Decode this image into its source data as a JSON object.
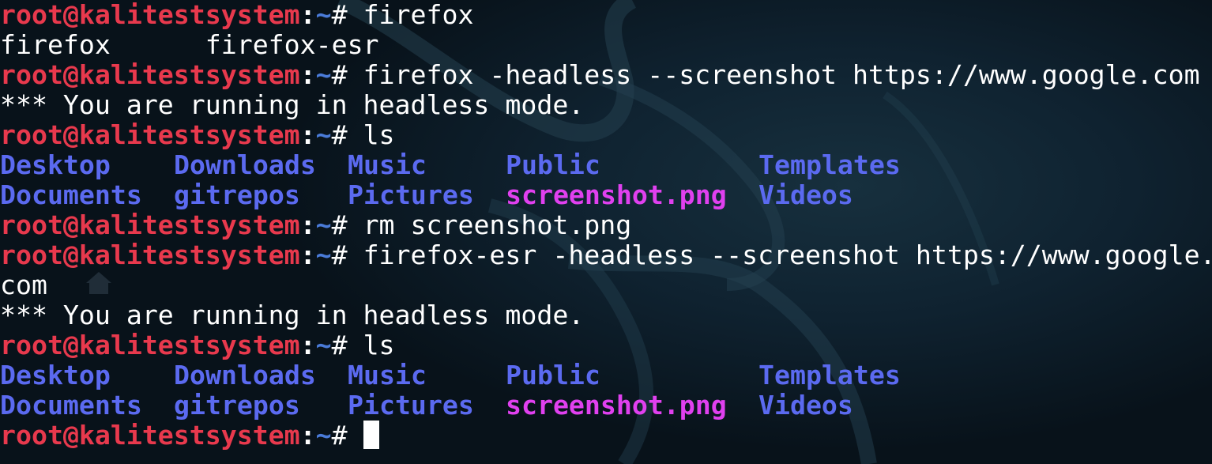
{
  "terminal": {
    "prompt": {
      "user_host": "root@kalitestsystem",
      "separator": ":",
      "path": "~",
      "symbol": "# "
    },
    "lines": [
      {
        "kind": "prompt",
        "command": "firefox"
      },
      {
        "kind": "output",
        "text": "firefox      firefox-esr"
      },
      {
        "kind": "prompt",
        "command": "firefox -headless --screenshot https://www.google.com"
      },
      {
        "kind": "output",
        "text": "*** You are running in headless mode."
      },
      {
        "kind": "prompt",
        "command": "ls"
      },
      {
        "kind": "ls",
        "items": [
          "Desktop",
          "Downloads",
          "Music",
          "Public",
          "Templates"
        ]
      },
      {
        "kind": "ls",
        "items": [
          "Documents",
          "gitrepos",
          "Pictures",
          "screenshot.png",
          "Videos"
        ]
      },
      {
        "kind": "prompt",
        "command": "rm screenshot.png"
      },
      {
        "kind": "prompt",
        "command": "firefox-esr -headless --screenshot https://www.google."
      },
      {
        "kind": "output",
        "text": "com"
      },
      {
        "kind": "output",
        "text": "*** You are running in headless mode."
      },
      {
        "kind": "prompt",
        "command": "ls"
      },
      {
        "kind": "ls",
        "items": [
          "Desktop",
          "Downloads",
          "Music",
          "Public",
          "Templates"
        ]
      },
      {
        "kind": "ls",
        "items": [
          "Documents",
          "gitrepos",
          "Pictures",
          "screenshot.png",
          "Videos"
        ]
      },
      {
        "kind": "prompt",
        "command": ""
      }
    ]
  },
  "colors": {
    "prompt_user": "#e8394d",
    "prompt_path": "#4a7bd8",
    "directory": "#5b6af0",
    "image_file": "#e040ef",
    "text": "#ffffff",
    "background": "#0a141c"
  },
  "icons": {
    "background_logo": "kali-dragon-icon",
    "desktop_shortcut": "home-folder-icon"
  }
}
